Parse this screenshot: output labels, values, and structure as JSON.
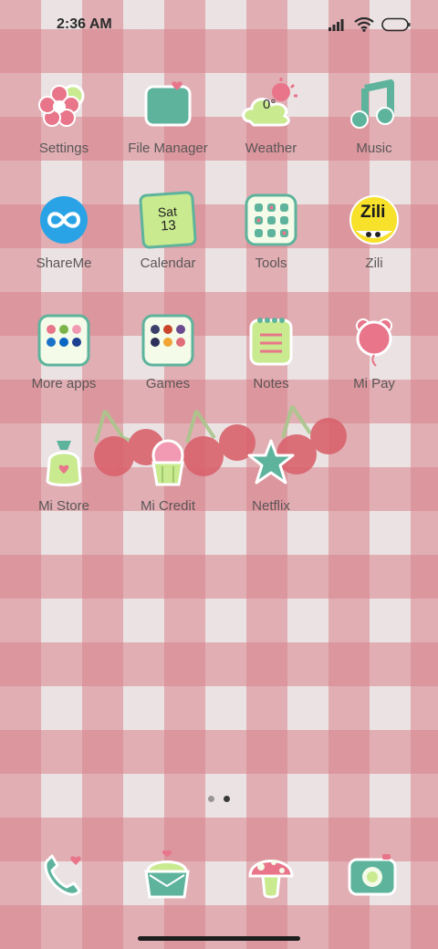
{
  "status": {
    "time": "2:36 AM"
  },
  "apps": [
    {
      "label": "Settings",
      "icon": "settings-flower-icon"
    },
    {
      "label": "File Manager",
      "icon": "folder-icon"
    },
    {
      "label": "Weather",
      "icon": "weather-cloud-icon",
      "temp": "0°"
    },
    {
      "label": "Music",
      "icon": "music-note-icon"
    },
    {
      "label": "ShareMe",
      "icon": "shareme-infinity-icon"
    },
    {
      "label": "Calendar",
      "icon": "calendar-icon",
      "day": "Sat",
      "date": "13"
    },
    {
      "label": "Tools",
      "icon": "tools-folder-icon"
    },
    {
      "label": "Zili",
      "icon": "zili-icon",
      "logo": "Zili"
    },
    {
      "label": "More apps",
      "icon": "more-apps-folder-icon"
    },
    {
      "label": "Games",
      "icon": "games-folder-icon"
    },
    {
      "label": "Notes",
      "icon": "notes-icon"
    },
    {
      "label": "Mi Pay",
      "icon": "mi-pay-bear-balloon-icon"
    },
    {
      "label": "Mi Store",
      "icon": "mi-store-bag-icon"
    },
    {
      "label": "Mi Credit",
      "icon": "mi-credit-cupcake-icon"
    },
    {
      "label": "Netflix",
      "icon": "netflix-star-icon"
    }
  ],
  "dock": [
    {
      "icon": "phone-icon"
    },
    {
      "icon": "messages-cupcake-icon"
    },
    {
      "icon": "browser-mushroom-icon"
    },
    {
      "icon": "camera-icon"
    }
  ],
  "page_indicator": {
    "pages": 2,
    "current": 2
  },
  "colors": {
    "green": "#5db39c",
    "pink": "#e8758a",
    "lime": "#c9ea8f",
    "cream": "#f4fbe8"
  }
}
